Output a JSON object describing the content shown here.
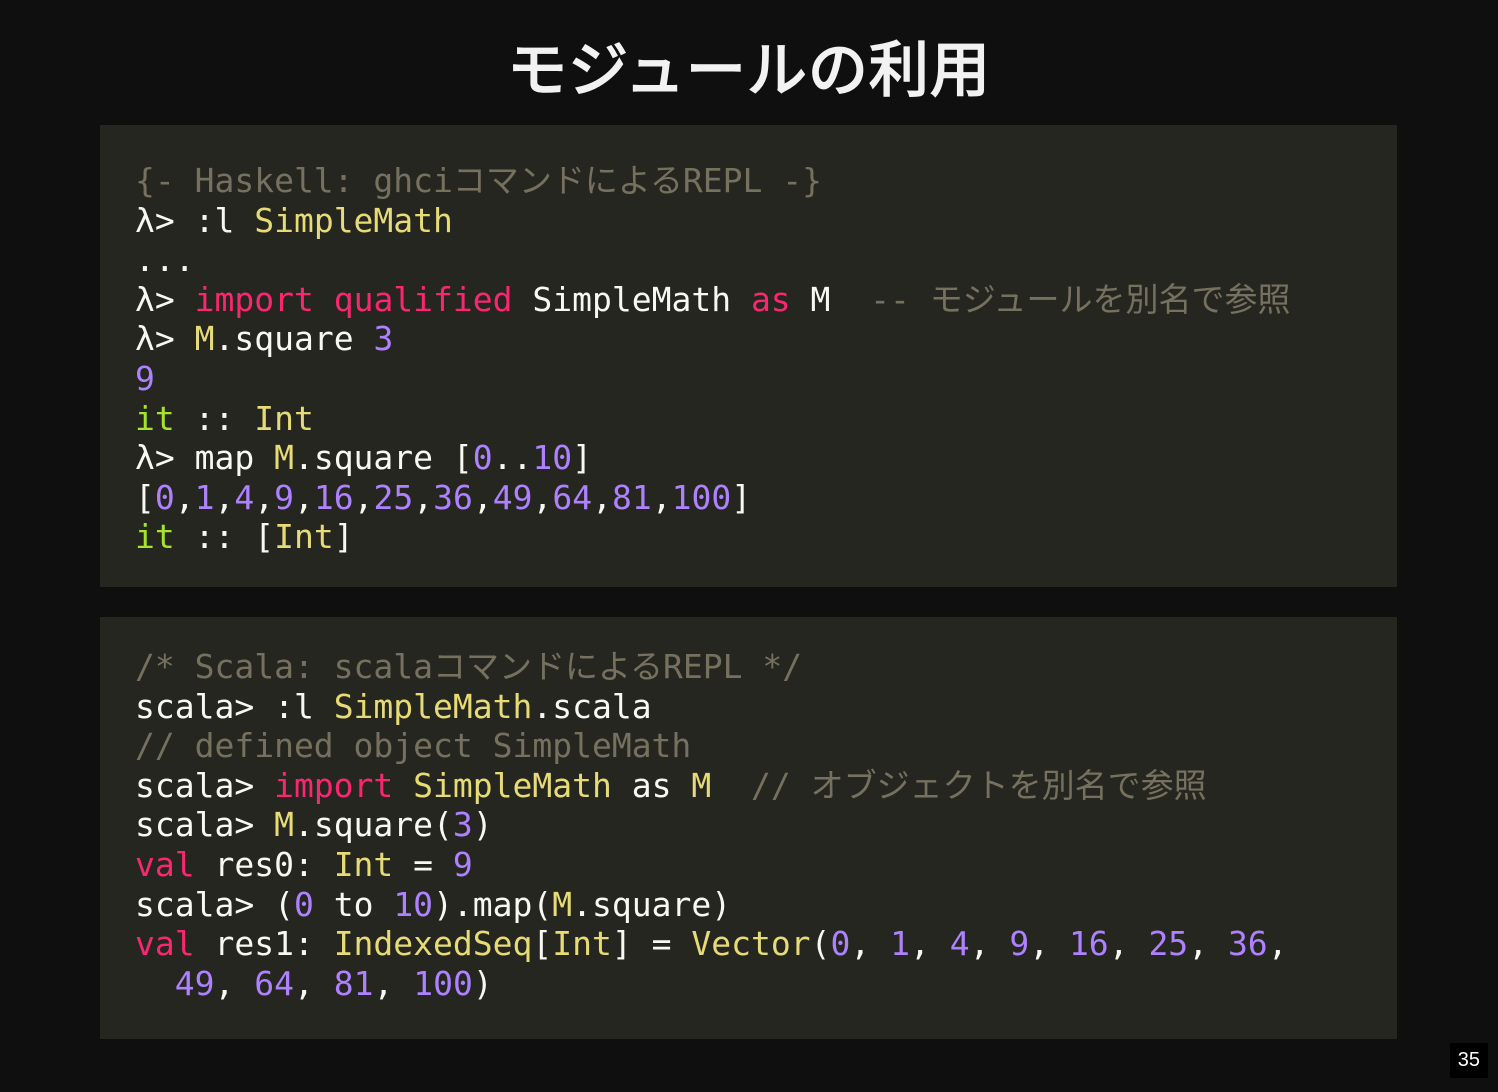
{
  "slide": {
    "title": "モジュールの利用",
    "page_number": "35"
  },
  "colors": {
    "background": "#0f0f0f",
    "code_background": "#262621",
    "comment": "#75715e",
    "plain": "#f8f8f2",
    "keyword": "#f92672",
    "type": "#e6db74",
    "number": "#ae81ff",
    "green": "#a6e22e"
  },
  "haskell_block": {
    "lines": [
      [
        {
          "t": "comment",
          "v": "{- Haskell: ghciコマンドによるREPL -}"
        }
      ],
      [
        {
          "t": "plain",
          "v": "λ> :l "
        },
        {
          "t": "type",
          "v": "SimpleMath"
        }
      ],
      [
        {
          "t": "plain",
          "v": "..."
        }
      ],
      [
        {
          "t": "plain",
          "v": "λ> "
        },
        {
          "t": "kw",
          "v": "import"
        },
        {
          "t": "plain",
          "v": " "
        },
        {
          "t": "kw",
          "v": "qualified"
        },
        {
          "t": "plain",
          "v": " SimpleMath "
        },
        {
          "t": "kw",
          "v": "as"
        },
        {
          "t": "plain",
          "v": " M  "
        },
        {
          "t": "comment",
          "v": "-- モジュールを別名で参照"
        }
      ],
      [
        {
          "t": "plain",
          "v": "λ> "
        },
        {
          "t": "type",
          "v": "M"
        },
        {
          "t": "plain",
          "v": ".square "
        },
        {
          "t": "num",
          "v": "3"
        }
      ],
      [
        {
          "t": "num",
          "v": "9"
        }
      ],
      [
        {
          "t": "green",
          "v": "it"
        },
        {
          "t": "plain",
          "v": " :: "
        },
        {
          "t": "type",
          "v": "Int"
        }
      ],
      [
        {
          "t": "plain",
          "v": "λ> map "
        },
        {
          "t": "type",
          "v": "M"
        },
        {
          "t": "plain",
          "v": ".square ["
        },
        {
          "t": "num",
          "v": "0"
        },
        {
          "t": "plain",
          "v": ".."
        },
        {
          "t": "num",
          "v": "10"
        },
        {
          "t": "plain",
          "v": "]"
        }
      ],
      [
        {
          "t": "plain",
          "v": "["
        },
        {
          "t": "num",
          "v": "0"
        },
        {
          "t": "plain",
          "v": ","
        },
        {
          "t": "num",
          "v": "1"
        },
        {
          "t": "plain",
          "v": ","
        },
        {
          "t": "num",
          "v": "4"
        },
        {
          "t": "plain",
          "v": ","
        },
        {
          "t": "num",
          "v": "9"
        },
        {
          "t": "plain",
          "v": ","
        },
        {
          "t": "num",
          "v": "16"
        },
        {
          "t": "plain",
          "v": ","
        },
        {
          "t": "num",
          "v": "25"
        },
        {
          "t": "plain",
          "v": ","
        },
        {
          "t": "num",
          "v": "36"
        },
        {
          "t": "plain",
          "v": ","
        },
        {
          "t": "num",
          "v": "49"
        },
        {
          "t": "plain",
          "v": ","
        },
        {
          "t": "num",
          "v": "64"
        },
        {
          "t": "plain",
          "v": ","
        },
        {
          "t": "num",
          "v": "81"
        },
        {
          "t": "plain",
          "v": ","
        },
        {
          "t": "num",
          "v": "100"
        },
        {
          "t": "plain",
          "v": "]"
        }
      ],
      [
        {
          "t": "green",
          "v": "it"
        },
        {
          "t": "plain",
          "v": " :: ["
        },
        {
          "t": "type",
          "v": "Int"
        },
        {
          "t": "plain",
          "v": "]"
        }
      ]
    ]
  },
  "scala_block": {
    "lines": [
      [
        {
          "t": "comment",
          "v": "/* Scala: scalaコマンドによるREPL */"
        }
      ],
      [
        {
          "t": "plain",
          "v": "scala> :l "
        },
        {
          "t": "type",
          "v": "SimpleMath"
        },
        {
          "t": "plain",
          "v": ".scala"
        }
      ],
      [
        {
          "t": "comment",
          "v": "// defined object SimpleMath"
        }
      ],
      [
        {
          "t": "plain",
          "v": "scala> "
        },
        {
          "t": "kw",
          "v": "import"
        },
        {
          "t": "plain",
          "v": " "
        },
        {
          "t": "type",
          "v": "SimpleMath"
        },
        {
          "t": "plain",
          "v": " as "
        },
        {
          "t": "type",
          "v": "M"
        },
        {
          "t": "plain",
          "v": "  "
        },
        {
          "t": "comment",
          "v": "// オブジェクトを別名で参照"
        }
      ],
      [
        {
          "t": "plain",
          "v": "scala> "
        },
        {
          "t": "type",
          "v": "M"
        },
        {
          "t": "plain",
          "v": ".square("
        },
        {
          "t": "num",
          "v": "3"
        },
        {
          "t": "plain",
          "v": ")"
        }
      ],
      [
        {
          "t": "kw",
          "v": "val"
        },
        {
          "t": "plain",
          "v": " res0: "
        },
        {
          "t": "type",
          "v": "Int"
        },
        {
          "t": "plain",
          "v": " = "
        },
        {
          "t": "num",
          "v": "9"
        }
      ],
      [
        {
          "t": "plain",
          "v": "scala> ("
        },
        {
          "t": "num",
          "v": "0"
        },
        {
          "t": "plain",
          "v": " to "
        },
        {
          "t": "num",
          "v": "10"
        },
        {
          "t": "plain",
          "v": ").map("
        },
        {
          "t": "type",
          "v": "M"
        },
        {
          "t": "plain",
          "v": ".square)"
        }
      ],
      [
        {
          "t": "kw",
          "v": "val"
        },
        {
          "t": "plain",
          "v": " res1: "
        },
        {
          "t": "type",
          "v": "IndexedSeq"
        },
        {
          "t": "plain",
          "v": "["
        },
        {
          "t": "type",
          "v": "Int"
        },
        {
          "t": "plain",
          "v": "] = "
        },
        {
          "t": "type",
          "v": "Vector"
        },
        {
          "t": "plain",
          "v": "("
        },
        {
          "t": "num",
          "v": "0"
        },
        {
          "t": "plain",
          "v": ", "
        },
        {
          "t": "num",
          "v": "1"
        },
        {
          "t": "plain",
          "v": ", "
        },
        {
          "t": "num",
          "v": "4"
        },
        {
          "t": "plain",
          "v": ", "
        },
        {
          "t": "num",
          "v": "9"
        },
        {
          "t": "plain",
          "v": ", "
        },
        {
          "t": "num",
          "v": "16"
        },
        {
          "t": "plain",
          "v": ", "
        },
        {
          "t": "num",
          "v": "25"
        },
        {
          "t": "plain",
          "v": ", "
        },
        {
          "t": "num",
          "v": "36"
        },
        {
          "t": "plain",
          "v": ","
        }
      ],
      [
        {
          "t": "plain",
          "v": "  "
        },
        {
          "t": "num",
          "v": "49"
        },
        {
          "t": "plain",
          "v": ", "
        },
        {
          "t": "num",
          "v": "64"
        },
        {
          "t": "plain",
          "v": ", "
        },
        {
          "t": "num",
          "v": "81"
        },
        {
          "t": "plain",
          "v": ", "
        },
        {
          "t": "num",
          "v": "100"
        },
        {
          "t": "plain",
          "v": ")"
        }
      ]
    ]
  }
}
